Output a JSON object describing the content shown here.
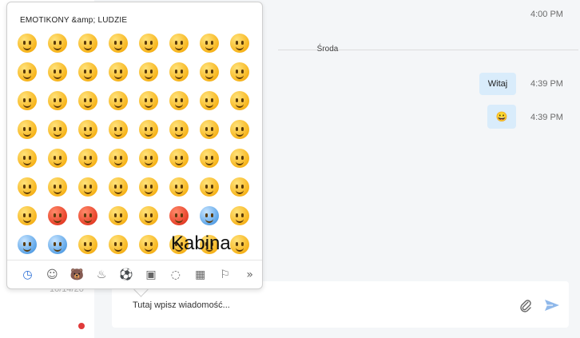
{
  "sidebar": {
    "date": "10/14/20"
  },
  "chat": {
    "top_time": "4:00 PM",
    "day_separator": "Środa",
    "messages": [
      {
        "text": "Witaj",
        "time": "4:39 PM"
      },
      {
        "text": "😀",
        "time": "4:39 PM"
      }
    ]
  },
  "composer": {
    "placeholder": "Tutaj wpisz wiadomość..."
  },
  "emoji_picker": {
    "title": "EMOTIKONY &amp; LUDZIE",
    "overlay_text": "Kabina",
    "rows": [
      [
        "grinning-face",
        "grinning-face-big-eyes",
        "grinning-face-smiling-eyes",
        "beaming-face",
        "grinning-squinting-face",
        "grinning-sweat",
        "face-tears-joy",
        "rolling-laughing"
      ],
      [
        "smiling-face",
        "smiling-face-smiling-eyes",
        "smiling-halo",
        "slightly-smiling",
        "upside-down-face",
        "winking-face",
        "relieved-face",
        "heart-eyes"
      ],
      [
        "smiling-hearts",
        "face-blowing-kiss",
        "kissing-face",
        "kissing-smiling-eyes",
        "kissing-closed-eyes",
        "face-savoring-food",
        "face-tongue",
        "squinting-tongue"
      ],
      [
        "winking-tongue",
        "zany-face",
        "raised-eyebrow",
        "monocle-face",
        "nerd-face",
        "sunglasses-face",
        "star-struck",
        "partying-face"
      ],
      [
        "smirking-face",
        "unamused-face",
        "disappointed-face",
        "pensive-face",
        "worried-face",
        "confused-face",
        "slightly-frowning",
        "frowning-face"
      ],
      [
        "persevering-face",
        "confounded-face",
        "tired-face",
        "weary-face",
        "pleading-face",
        "crying-face",
        "loudly-crying",
        "steam-nose"
      ],
      [
        "pouting-face",
        "angry-face",
        "cursing-face",
        "exploding-head",
        "flushed-face",
        "hot-face",
        "cold-face",
        "screaming-face"
      ],
      [
        "anxious-sweat",
        "fearful-face",
        "sad-relieved",
        "downcast-sweat",
        "hugging-face",
        "thinking-face",
        "shushing-face",
        "hand-over-mouth"
      ]
    ],
    "red_faces": [
      "angry-face",
      "cursing-face",
      "hot-face"
    ],
    "blue_faces": [
      "cold-face",
      "anxious-sweat",
      "fearful-face"
    ],
    "categories": [
      {
        "name": "recent-icon",
        "glyph": "◷"
      },
      {
        "name": "smiley-icon",
        "glyph": "☺"
      },
      {
        "name": "animal-icon",
        "glyph": "🐻"
      },
      {
        "name": "food-icon",
        "glyph": "♨"
      },
      {
        "name": "activity-icon",
        "glyph": "⚽"
      },
      {
        "name": "travel-icon",
        "glyph": "▣"
      },
      {
        "name": "objects-icon",
        "glyph": "◌"
      },
      {
        "name": "symbols-icon",
        "glyph": "▦"
      },
      {
        "name": "flags-icon",
        "glyph": "⚐"
      },
      {
        "name": "more-icon",
        "glyph": "»"
      }
    ]
  }
}
